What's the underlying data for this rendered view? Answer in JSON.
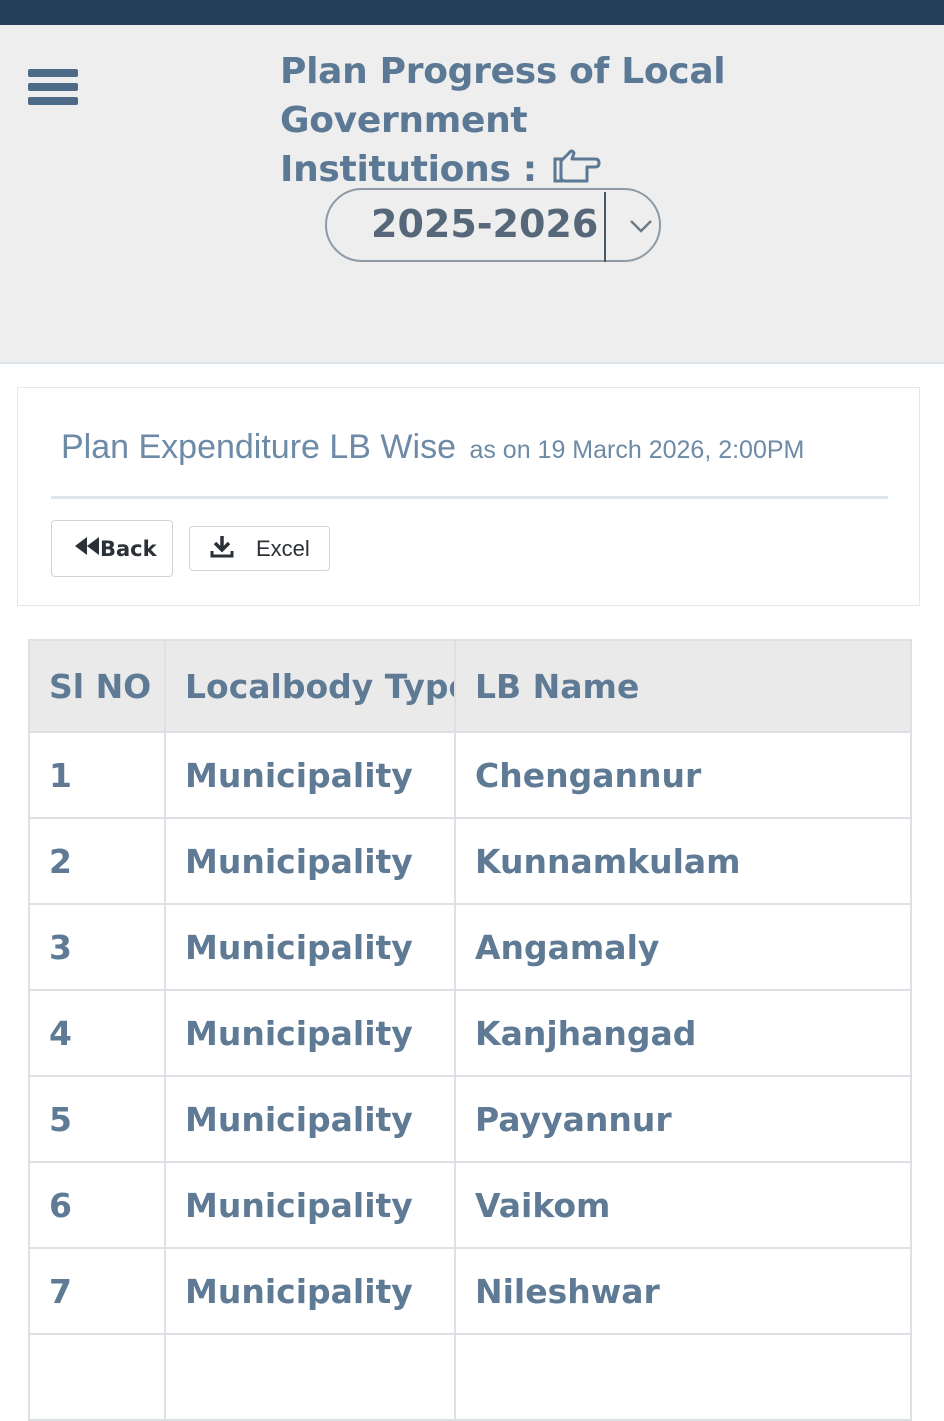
{
  "header": {
    "title_line1": "Plan Progress of Local Government",
    "title_line2": "Institutions :",
    "hand_icon": "hand-pointing-right-icon",
    "menu_icon": "hamburger-menu-icon"
  },
  "year_select": {
    "value": "2025-2026",
    "icon": "chevron-down-icon"
  },
  "card": {
    "title": "Plan Expenditure LB Wise",
    "as_of": "as on 19 March 2026, 2:00PM",
    "back_label": "Back",
    "excel_label": "Excel",
    "back_icon": "fast-backward-icon",
    "excel_icon": "download-icon"
  },
  "table": {
    "headers": [
      "Sl NO",
      "Localbody Type",
      "LB Name"
    ],
    "rows": [
      {
        "sl": "1",
        "type": "Municipality",
        "name": "Chengannur"
      },
      {
        "sl": "2",
        "type": "Municipality",
        "name": "Kunnamkulam"
      },
      {
        "sl": "3",
        "type": "Municipality",
        "name": "Angamaly"
      },
      {
        "sl": "4",
        "type": "Municipality",
        "name": "Kanjhangad"
      },
      {
        "sl": "5",
        "type": "Municipality",
        "name": "Payyannur"
      },
      {
        "sl": "6",
        "type": "Municipality",
        "name": "Vaikom"
      },
      {
        "sl": "7",
        "type": "Municipality",
        "name": "Nileshwar"
      },
      {
        "sl": "",
        "type": "",
        "name": ""
      }
    ]
  },
  "colors": {
    "topbar": "#263f58",
    "header_bg": "#eeeeee",
    "text_accent": "#5f7a95"
  }
}
